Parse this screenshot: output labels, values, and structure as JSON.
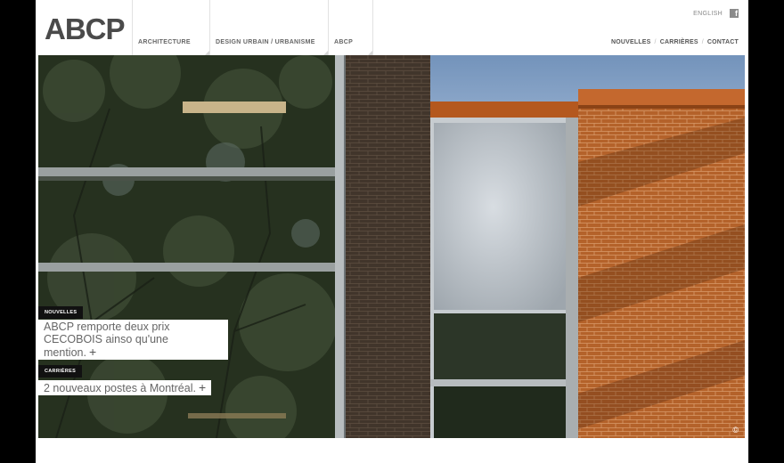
{
  "brand": {
    "logo_text": "ABCP"
  },
  "main_nav": [
    {
      "label": "ARCHITECTURE"
    },
    {
      "label": "DESIGN URBAIN / URBANISME"
    },
    {
      "label": "ABCP"
    }
  ],
  "utility": {
    "language": "ENGLISH",
    "facebook_icon": "facebook-icon"
  },
  "top_links": [
    {
      "label": "NOUVELLES"
    },
    {
      "label": "CARRIÈRES"
    },
    {
      "label": "CONTACT"
    }
  ],
  "hero": {
    "news": {
      "tag": "NOUVELLES",
      "text": "ABCP remporte deux prix CECOBOIS ainso qu'une mention.",
      "more_icon": "plus-icon"
    },
    "jobs": {
      "tag": "CARRIÈRES",
      "text": "2 nouveaux postes à Montréal.",
      "more_icon": "plus-icon"
    },
    "copyright": "©"
  },
  "colors": {
    "text_grey": "#666666",
    "nav_border": "#e2e2e2",
    "tag_bg": "#111111",
    "brick": "#b4622a",
    "sky": "#7a9ac0"
  }
}
